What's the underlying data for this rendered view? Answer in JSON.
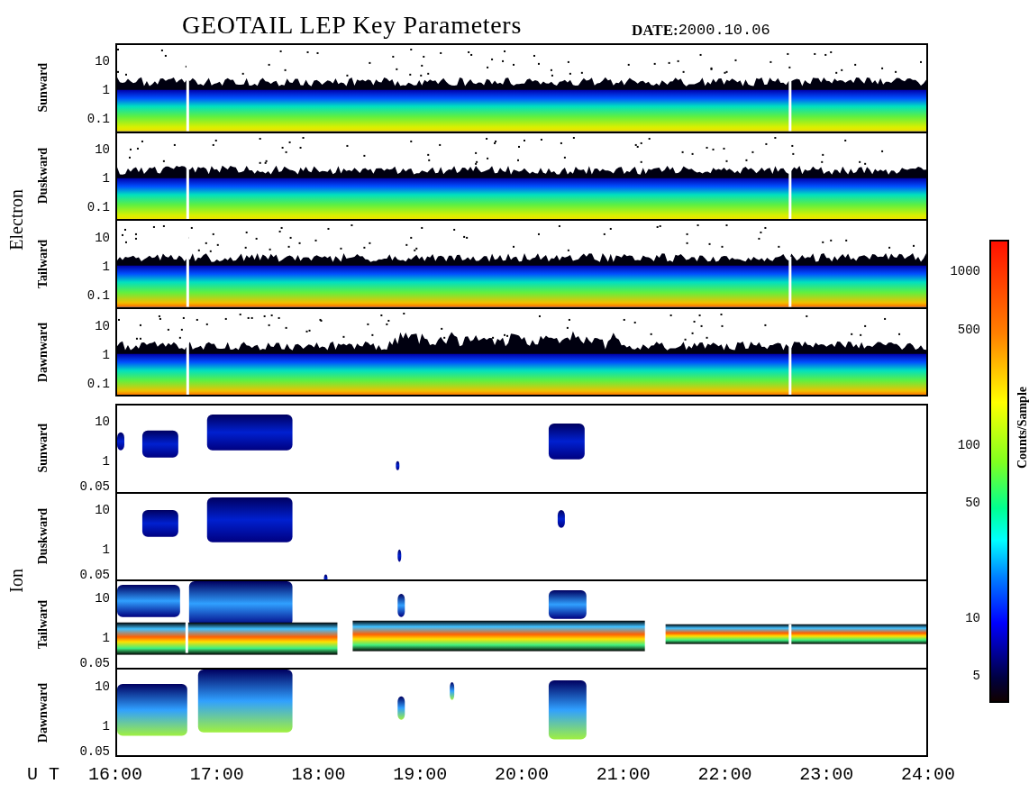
{
  "title": "GEOTAIL LEP Key Parameters",
  "date": {
    "label": "DATE:",
    "value": "2000.10.06"
  },
  "groups": [
    {
      "name": "Electron",
      "kind": "electron",
      "panels": [
        {
          "direction": "Sunward",
          "yticks": [
            "10",
            "1",
            "0.1"
          ]
        },
        {
          "direction": "Duskward",
          "yticks": [
            "10",
            "1",
            "0.1"
          ]
        },
        {
          "direction": "Tailward",
          "yticks": [
            "10",
            "1",
            "0.1"
          ]
        },
        {
          "direction": "Dawnward",
          "yticks": [
            "10",
            "1",
            "0.1"
          ]
        }
      ]
    },
    {
      "name": "Ion",
      "kind": "ion",
      "panels": [
        {
          "direction": "Sunward",
          "yticks": [
            "10",
            "1",
            "0.05"
          ]
        },
        {
          "direction": "Duskward",
          "yticks": [
            "10",
            "1",
            "0.05"
          ]
        },
        {
          "direction": "Tailward",
          "yticks": [
            "10",
            "1",
            "0.05"
          ]
        },
        {
          "direction": "Dawnward",
          "yticks": [
            "10",
            "1",
            "0.05"
          ]
        }
      ]
    }
  ],
  "colorbar": {
    "title": "Counts/Sample",
    "ticks": [
      "1000",
      "500",
      "100",
      "50",
      "10",
      "5"
    ]
  },
  "time_axis": {
    "label": "U T",
    "ticks": [
      "16:00",
      "17:00",
      "18:00",
      "19:00",
      "20:00",
      "21:00",
      "22:00",
      "23:00",
      "24:00"
    ]
  }
}
